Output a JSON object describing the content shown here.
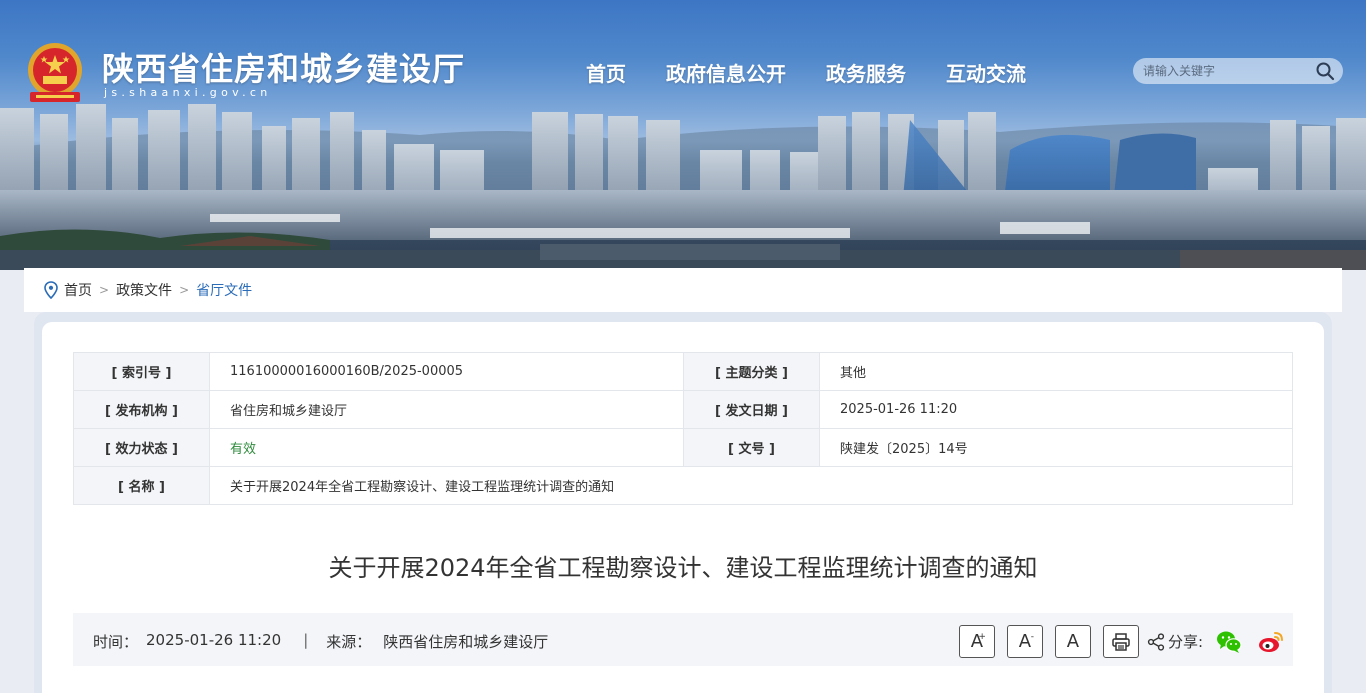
{
  "header": {
    "site_title": "陕西省住房和城乡建设厅",
    "site_domain": "js.shaanxi.gov.cn",
    "nav": [
      "首页",
      "政府信息公开",
      "政务服务",
      "互动交流"
    ],
    "search_placeholder": "请输入关键字"
  },
  "breadcrumb": {
    "items": [
      "首页",
      "政策文件",
      "省厅文件"
    ],
    "separator": ">"
  },
  "meta": {
    "index_label": "[ 索引号 ]",
    "index_value": "11610000016000160B/2025-00005",
    "topic_label": "[ 主题分类 ]",
    "topic_value": "其他",
    "org_label": "[ 发布机构 ]",
    "org_value": "省住房和城乡建设厅",
    "date_label": "[ 发文日期 ]",
    "date_value": "2025-01-26 11:20",
    "status_label": "[ 效力状态 ]",
    "status_value": "有效",
    "docno_label": "[ 文号 ]",
    "docno_value": "陕建发〔2025〕14号",
    "name_label": "[ 名称 ]",
    "name_value": "关于开展2024年全省工程勘察设计、建设工程监理统计调查的通知"
  },
  "article": {
    "title": "关于开展2024年全省工程勘察设计、建设工程监理统计调查的通知",
    "time_label": "时间：",
    "time_value": "2025-01-26 11:20",
    "divider": "|",
    "source_label": "来源：",
    "source_value": "陕西省住房和城乡建设厅",
    "font_up": "A",
    "font_down": "A",
    "font_reset": "A",
    "share_label": "分享:"
  },
  "colors": {
    "link_active": "#2b6cb8",
    "status_valid": "#2e8b3c",
    "wechat": "#2dc100",
    "weibo": "#e6162d"
  }
}
